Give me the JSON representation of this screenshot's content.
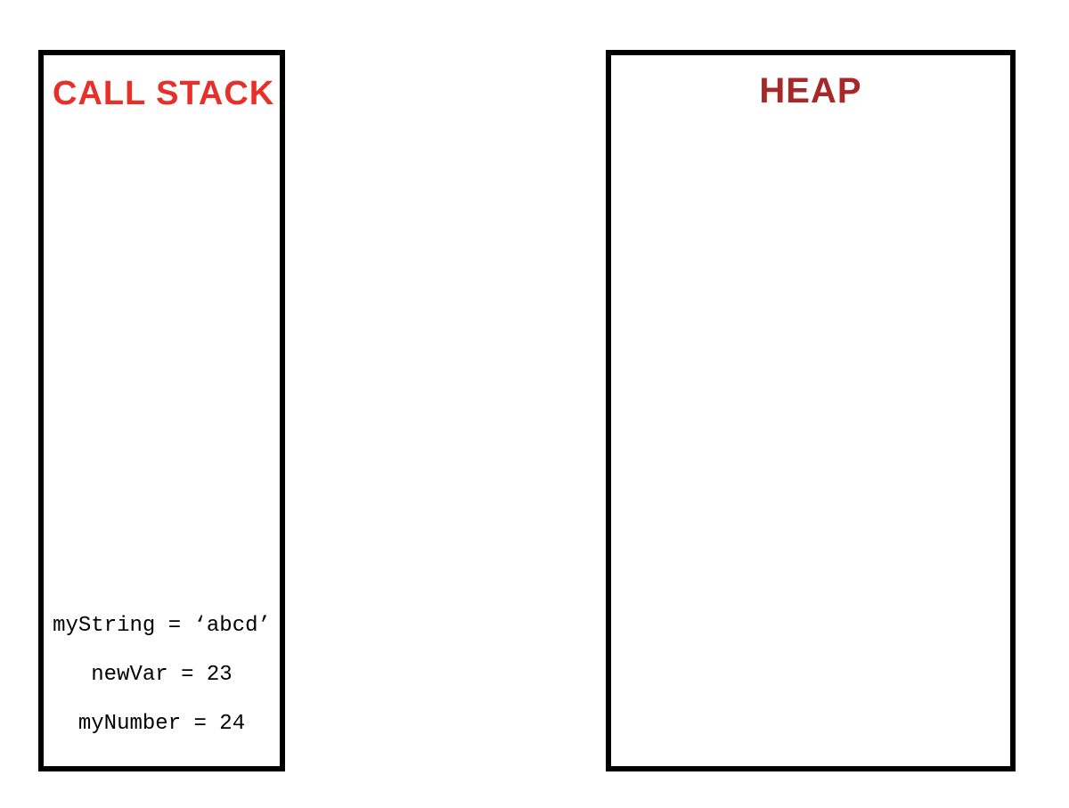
{
  "callStack": {
    "title": "CALL STACK",
    "variables": [
      {
        "text": "myString = ‘abcd’"
      },
      {
        "text": "newVar = 23"
      },
      {
        "text": "myNumber = 24"
      }
    ]
  },
  "heap": {
    "title": "HEAP"
  }
}
